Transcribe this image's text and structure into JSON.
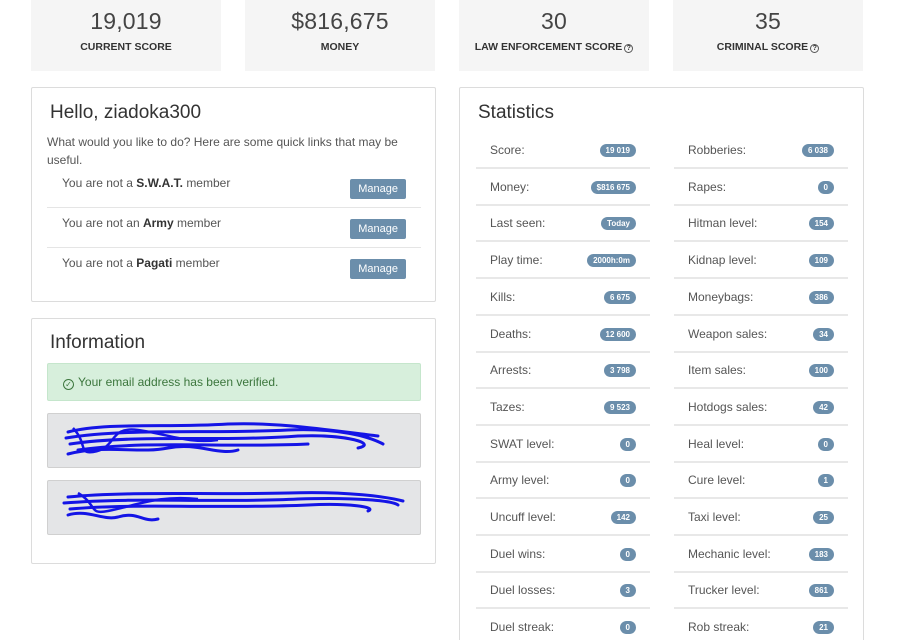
{
  "top_stats": [
    {
      "value": "19,019",
      "label": "CURRENT SCORE",
      "help": false
    },
    {
      "value": "$816,675",
      "label": "MONEY",
      "help": false
    },
    {
      "value": "30",
      "label": "LAW ENFORCEMENT SCORE",
      "help": true
    },
    {
      "value": "35",
      "label": "CRIMINAL SCORE",
      "help": true
    }
  ],
  "hello": {
    "title": "Hello, ziadoka300",
    "intro": "What would you like to do? Here are some quick links that may be useful.",
    "memberships": [
      {
        "prefix": "You are not a",
        "group": "S.W.A.T.",
        "suffix": "member",
        "button": "Manage"
      },
      {
        "prefix": "You are not an",
        "group": "Army",
        "suffix": "member",
        "button": "Manage"
      },
      {
        "prefix": "You are not a",
        "group": "Pagati",
        "suffix": "member",
        "button": "Manage"
      }
    ]
  },
  "information": {
    "title": "Information",
    "alert": "Your email address has been verified."
  },
  "statistics": {
    "title": "Statistics",
    "left": [
      {
        "label": "Score:",
        "value": "19 019"
      },
      {
        "label": "Money:",
        "value": "$816 675"
      },
      {
        "label": "Last seen:",
        "value": "Today"
      },
      {
        "label": "Play time:",
        "value": "2000h:0m"
      },
      {
        "label": "Kills:",
        "value": "6 675"
      },
      {
        "label": "Deaths:",
        "value": "12 600"
      },
      {
        "label": "Arrests:",
        "value": "3 798"
      },
      {
        "label": "Tazes:",
        "value": "9 523"
      },
      {
        "label": "SWAT level:",
        "value": "0"
      },
      {
        "label": "Army level:",
        "value": "0"
      },
      {
        "label": "Uncuff level:",
        "value": "142"
      },
      {
        "label": "Duel wins:",
        "value": "0"
      },
      {
        "label": "Duel losses:",
        "value": "3"
      },
      {
        "label": "Duel streak:",
        "value": "0"
      }
    ],
    "right": [
      {
        "label": "Robberies:",
        "value": "6 038"
      },
      {
        "label": "Rapes:",
        "value": "0"
      },
      {
        "label": "Hitman level:",
        "value": "154"
      },
      {
        "label": "Kidnap level:",
        "value": "109"
      },
      {
        "label": "Moneybags:",
        "value": "386"
      },
      {
        "label": "Weapon sales:",
        "value": "34"
      },
      {
        "label": "Item sales:",
        "value": "100"
      },
      {
        "label": "Hotdogs sales:",
        "value": "42"
      },
      {
        "label": "Heal level:",
        "value": "0"
      },
      {
        "label": "Cure level:",
        "value": "1"
      },
      {
        "label": "Taxi level:",
        "value": "25"
      },
      {
        "label": "Mechanic level:",
        "value": "183"
      },
      {
        "label": "Trucker level:",
        "value": "861"
      },
      {
        "label": "Rob streak:",
        "value": "21"
      }
    ]
  }
}
